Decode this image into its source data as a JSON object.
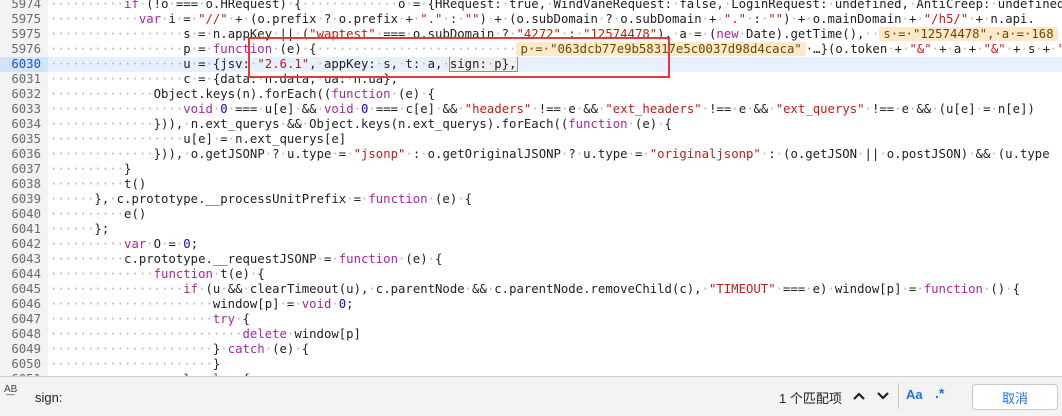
{
  "editor": {
    "lines": [
      {
        "no": "5974",
        "text": "··········if·(!o·===·o.H5Request)·{·············\"o·=·{H5Request:·true,·WindVaneRequest:·false,·LoginRequest:·undefined,·AntiCreep:·undefined,·AntiF"
      },
      {
        "no": "5975",
        "text": "············var·i·=·\"//\"·+·(o.prefix·?·o.prefix·+·\".\"·:·\"\")·+·(o.subDomain·?·o.subDomain·+·\".\"·:·\"\")·+·o.mainDomain·+·\"/h5/\"·+·n.api."
      },
      {
        "no": "5975",
        "text": "··················s·=·n.appKey·||·(\"waptest\"·===·o.subDomain·?·\"4272\"·:·\"12574478\"),·a·=·(new·Date).getTime(),··"
      },
      {
        "no": "5976",
        "text": "··················p·=·function·(e)·{···························…}(o.token·+·\"&\"·+·a·+·\"&\"·+·s·+·\"&\"·+·n.data),··"
      },
      {
        "no": "6030",
        "text": "··················u·=·{jsv:·\"2.6.1\",·appKey:·s,·t:·a,·sign:·p},"
      },
      {
        "no": "6031",
        "text": "··················c·=·{data:·n.data,·ua:·n.ua};"
      },
      {
        "no": "6032",
        "text": "··············Object.keys(n).forEach((function·(e)·{"
      },
      {
        "no": "6033",
        "text": "··················void·0·===·u[e]·&&·void·0·===·c[e]·&&·\"headers\"·!==·e·&&·\"ext_headers\"·!==·e·&&·\"ext_querys\"·!==·e·&&·(u[e]·=·n[e])"
      },
      {
        "no": "6034",
        "text": "··············})),·n.ext_querys·&&·Object.keys(n.ext_querys).forEach((function·(e)·{"
      },
      {
        "no": "6035",
        "text": "··················u[e]·=·n.ext_querys[e]"
      },
      {
        "no": "6036",
        "text": "··············})),·o.getJSONP·?·u.type·=·\"jsonp\"·:·o.getOriginalJSONP·?·u.type·=·\"originaljsonp\"·:·(o.getJSON·||·o.postJSON)·&&·(u.type"
      },
      {
        "no": "6037",
        "text": "··········}"
      },
      {
        "no": "6038",
        "text": "··········t()"
      },
      {
        "no": "6039",
        "text": "······},·c.prototype.__processUnitPrefix·=·function·(e)·{"
      },
      {
        "no": "6040",
        "text": "··········e()"
      },
      {
        "no": "6041",
        "text": "······};"
      },
      {
        "no": "6042",
        "text": "··········var·O·=·0;"
      },
      {
        "no": "6043",
        "text": "··········c.prototype.__requestJSONP·=·function·(e)·{"
      },
      {
        "no": "6044",
        "text": "··············function·t(e)·{"
      },
      {
        "no": "6045",
        "text": "··················if·(u·&&·clearTimeout(u),·c.parentNode·&&·c.parentNode.removeChild(c),·\"TIMEOUT\"·===·e)·window[p]·=·function·()·{"
      },
      {
        "no": "6046",
        "text": "······················window[p]·=·void·0;"
      },
      {
        "no": "6047",
        "text": "······················try·{"
      },
      {
        "no": "6048",
        "text": "··························delete·window[p]"
      },
      {
        "no": "6049",
        "text": "······················}·catch·(e)·{"
      },
      {
        "no": "6050",
        "text": "······················}"
      },
      {
        "no": "6051",
        "text": "··················};·else·{"
      }
    ],
    "active_line": "6030",
    "inline_values": {
      "line5975b": "s·=·\"12574478\",·a·=·168",
      "line5976_p": "p·=·\"063dcb77e9b58317e5c0037d98d4caca\"",
      "line5976_o": "o·=·{H5Re"
    },
    "search_match": "sign:·p"
  },
  "search_bar": {
    "case_icon": "A͟B",
    "query": "sign:",
    "match_count": "1 个匹配项",
    "prev_icon": "chevron-up",
    "next_icon": "chevron-down",
    "match_case_label": "Aa",
    "regex_label": ".*",
    "cancel_label": "取消"
  }
}
